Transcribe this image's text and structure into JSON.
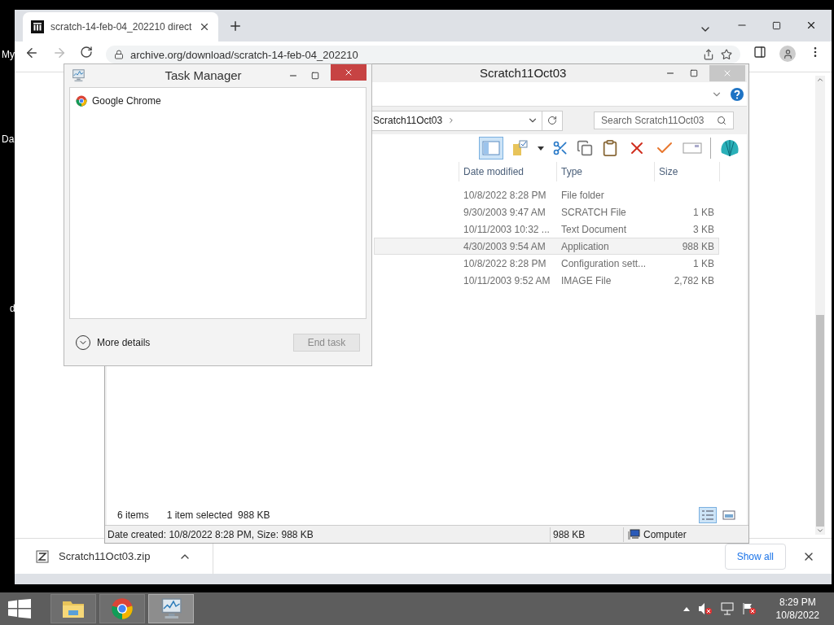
{
  "desktop": {
    "icon_labels": [
      "My",
      "Da",
      "d"
    ]
  },
  "browser": {
    "tab": {
      "title": "scratch-14-feb-04_202210 direct",
      "selected": true
    },
    "address": "archive.org/download/scratch-14-feb-04_202210",
    "download": {
      "file": "Scratch11Oct03.zip"
    },
    "show_all": "Show all"
  },
  "explorer": {
    "title": "Scratch11Oct03",
    "breadcrumb": "Scratch11Oct03",
    "search_placeholder": "Search Scratch11Oct03",
    "columns": [
      "Date modified",
      "Type",
      "Size"
    ],
    "rows": [
      {
        "date": "10/8/2022 8:28 PM",
        "type": "File folder",
        "selected": false
      },
      {
        "date": "9/30/2003 9:47 AM",
        "type": "SCRATCH File",
        "size": "1 KB",
        "selected": false
      },
      {
        "date": "10/11/2003 10:32 ...",
        "type": "Text Document",
        "size": "3 KB",
        "selected": false
      },
      {
        "date": "4/30/2003 9:54 AM",
        "type": "Application",
        "size": "988 KB",
        "selected": true
      },
      {
        "date": "10/8/2022 8:28 PM",
        "type": "Configuration sett...",
        "size": "1 KB",
        "selected": false
      },
      {
        "date": "10/11/2003 9:52 AM",
        "type": "IMAGE File",
        "size": "2,782 KB",
        "selected": false
      }
    ],
    "status": {
      "count": "6 items",
      "selection": "1 item selected  988 KB"
    },
    "details": {
      "info": "Date created: 10/8/2022 8:28 PM, Size: 988 KB",
      "size": "988 KB",
      "zone": "Computer"
    }
  },
  "task_manager": {
    "title": "Task Manager",
    "apps": [
      "Google Chrome"
    ],
    "more_details": "More details",
    "end_task": {
      "label": "End task",
      "disabled": true
    }
  },
  "taskbar": {
    "apps": [
      {
        "kind": "explorer",
        "selected": false
      },
      {
        "kind": "chrome",
        "selected": false
      },
      {
        "kind": "taskmanager",
        "selected": true
      }
    ],
    "time": "8:29 PM",
    "date": "10/8/2022"
  }
}
